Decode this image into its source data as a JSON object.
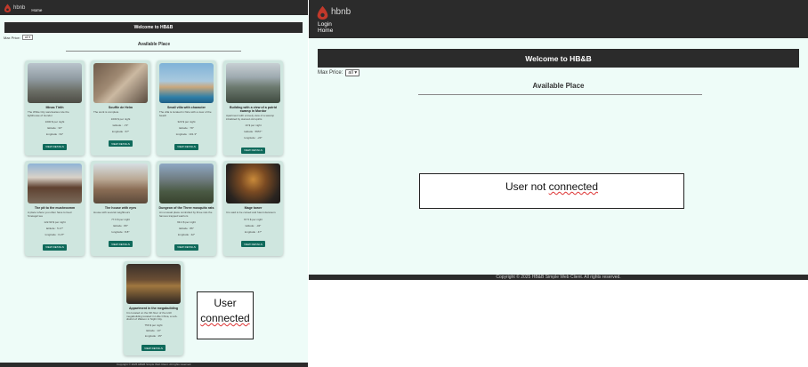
{
  "colors": {
    "header": "#2b2b2b",
    "page_bg": "#eefcf8",
    "card_bg": "#cfe6df",
    "button": "#0f6a5b",
    "logo": "#c0392b"
  },
  "left": {
    "brand": "hbnb",
    "nav_home": "Home",
    "welcome": "Welcome to HB&B",
    "max_price_label": "Max Price:",
    "max_price_value": "all",
    "available_title": "Available Place",
    "places": [
      {
        "title": "Minas Tirith",
        "description": "The White City sanctuaries rule the lighthouse of Gondor",
        "price": "1000 $ per night",
        "latitude": "latitude : 33°",
        "longitude": "longitude : 64°",
        "button": "VIEW DETAILS"
      },
      {
        "title": "Souffle de Helm",
        "description": "The work is complete",
        "price": "1033 $ per night",
        "latitude": "latitude : -74°",
        "longitude": "longitude : 67°",
        "button": "VIEW DETAILS"
      },
      {
        "title": "Small villa with character",
        "description": "The villa is located in Nice with a view of the beach",
        "price": "320 $ per night",
        "latitude": "latitude : 79°",
        "longitude": "longitude : 101.3°",
        "button": "VIEW DETAILS"
      },
      {
        "title": "Building with a view of a putrid swamp in Mordor",
        "description": "Apartment with a lovely view of a swamp inhabited by starved old spirits",
        "price": "10 $ per night",
        "latitude": "latitude : 5557°",
        "longitude": "longitude : -23°",
        "button": "VIEW DETAILS"
      },
      {
        "title": "The pit to the mushroomm",
        "description": "A place where you often have to feed Sméagol tea",
        "price": "122.90 $ per night",
        "latitude": "latitude : 5.17°",
        "longitude": "longitude : 6.27°",
        "button": "VIEW DETAILS"
      },
      {
        "title": "The house with eyes",
        "description": "House with several neighbours",
        "price": "77.6 $ per night",
        "latitude": "latitude : 80°",
        "longitude": "longitude : 8.8°",
        "button": "VIEW DETAILS"
      },
      {
        "title": "Dungeon of the Three mosquito rats",
        "description": "An unusual place controlled by three rats the famous trapped warriors",
        "price": "99.4 $ per night",
        "latitude": "latitude : 86°",
        "longitude": "longitude : 42°",
        "button": "VIEW DETAILS"
      },
      {
        "title": "Mage tower",
        "description": "It is said to be cursed and haunt danceurs",
        "price": "67.5 $ per night",
        "latitude": "latitude : -34°",
        "longitude": "longitude : 47°",
        "button": "VIEW DETAILS"
      },
      {
        "title": "Appartment in the megabuilding",
        "description": "It is located on the 9th floor of the H10 megabuilding located in Little China, a sub-district of Watson in Night City.",
        "price": "756 $ per night",
        "latitude": "latitude : 13°",
        "longitude": "longitude : 25°",
        "button": "VIEW DETAILS"
      }
    ],
    "annotation": "User connected",
    "annotation_lines": [
      "User",
      "connected"
    ],
    "footer": "Copyright © 2025 HB&B Simple Web Client. All rights reserved."
  },
  "right": {
    "brand": "hbnb",
    "nav_login": "Login",
    "nav_home": "Home",
    "welcome": "Welcome to HB&B",
    "max_price_label": "Max Price:",
    "max_price_value": "all",
    "available_title": "Available Place",
    "annotation_prefix": "User not ",
    "annotation_word": "connected",
    "footer": "Copyright © 2025 HB&B Simple Web Client. All rights reserved."
  }
}
